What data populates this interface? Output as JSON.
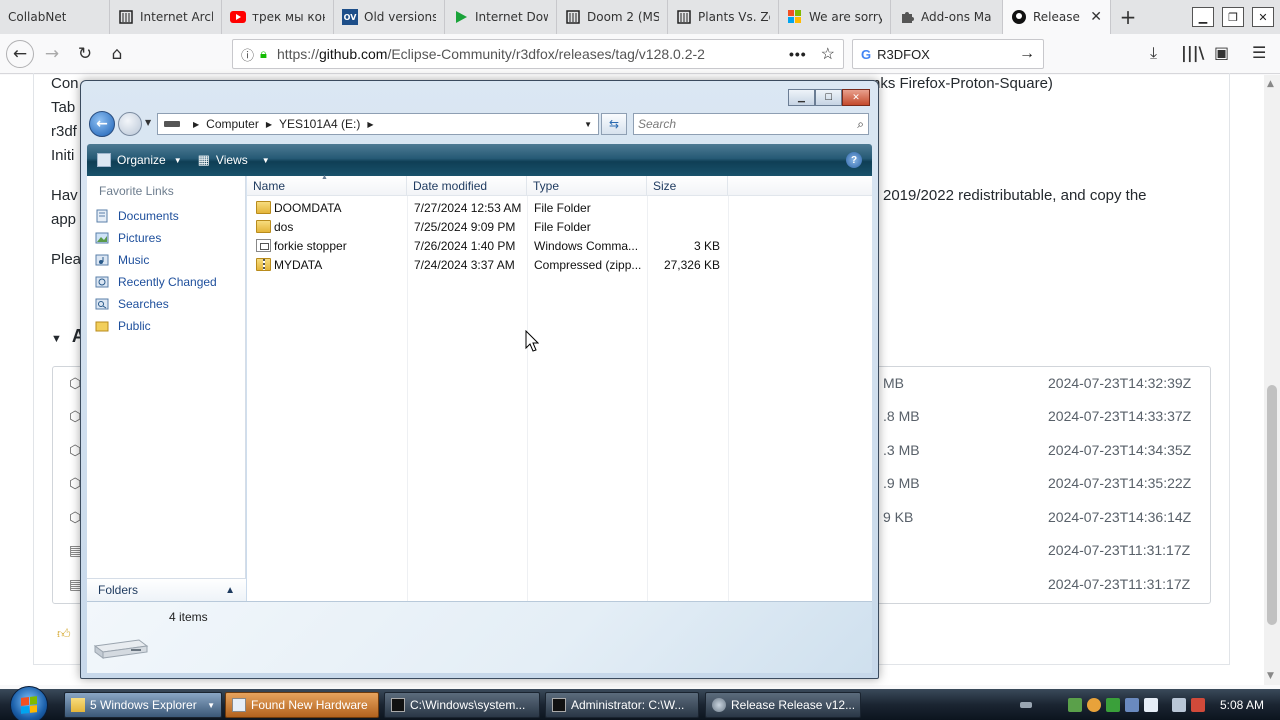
{
  "browser": {
    "tabs": [
      {
        "label": "CollabNet",
        "icon": "collabnet-icon"
      },
      {
        "label": "Internet Arch",
        "icon": "archive-icon"
      },
      {
        "label": "трек мы кон",
        "icon": "youtube-icon"
      },
      {
        "label": "Old versions",
        "icon": "oldversion-icon"
      },
      {
        "label": "Internet Dow",
        "icon": "play-icon"
      },
      {
        "label": "Doom 2 (MS",
        "icon": "archive-icon"
      },
      {
        "label": "Plants Vs. Zo",
        "icon": "archive-icon"
      },
      {
        "label": "We are sorry,",
        "icon": "microsoft-icon"
      },
      {
        "label": "Add-ons Ma",
        "icon": "puzzle-icon"
      },
      {
        "label": "Release R",
        "icon": "github-icon"
      }
    ],
    "url": "https://github.com/Eclipse-Community/r3dfox/releases/tag/v128.0.2-2",
    "url_host": "github.com",
    "search_text": "R3DFOX"
  },
  "page": {
    "lines": [
      "Con",
      "nks Firefox-Proton-Square)",
      "Tab",
      "r3df",
      "Initi",
      "Hav",
      "2019/2022 redistributable, and copy the",
      "app",
      "Plea"
    ],
    "assets_label": "A",
    "assets": [
      {
        "size": "MB",
        "date": "2024-07-23T14:32:39Z"
      },
      {
        "size": ".8 MB",
        "date": "2024-07-23T14:33:37Z"
      },
      {
        "size": ".3 MB",
        "date": "2024-07-23T14:34:35Z"
      },
      {
        "size": ".9 MB",
        "date": "2024-07-23T14:35:22Z"
      },
      {
        "size": "9 KB",
        "date": "2024-07-23T14:36:14Z"
      },
      {
        "size": "",
        "date": "2024-07-23T11:31:17Z"
      },
      {
        "size": "",
        "date": "2024-07-23T11:31:17Z"
      }
    ]
  },
  "explorer": {
    "breadcrumb": [
      "Computer",
      "YES101A4 (E:)"
    ],
    "search_placeholder": "Search",
    "toolbar": {
      "organize": "Organize",
      "views": "Views"
    },
    "favorite_links_header": "Favorite Links",
    "favorites": [
      {
        "label": "Documents",
        "icon": "documents-icon"
      },
      {
        "label": "Pictures",
        "icon": "pictures-icon"
      },
      {
        "label": "Music",
        "icon": "music-icon"
      },
      {
        "label": "Recently Changed",
        "icon": "recent-icon"
      },
      {
        "label": "Searches",
        "icon": "searches-icon"
      },
      {
        "label": "Public",
        "icon": "public-folder-icon"
      }
    ],
    "folders_label": "Folders",
    "columns": [
      "Name",
      "Date modified",
      "Type",
      "Size"
    ],
    "files": [
      {
        "name": "DOOMDATA",
        "date": "7/27/2024 12:53 AM",
        "type": "File Folder",
        "size": "",
        "icon": "folder-icon"
      },
      {
        "name": "dos",
        "date": "7/25/2024 9:09 PM",
        "type": "File Folder",
        "size": "",
        "icon": "folder-icon"
      },
      {
        "name": "forkie stopper",
        "date": "7/26/2024 1:40 PM",
        "type": "Windows Comma...",
        "size": "3 KB",
        "icon": "batch-file-icon"
      },
      {
        "name": "MYDATA",
        "date": "7/24/2024 3:37 AM",
        "type": "Compressed (zipp...",
        "size": "27,326 KB",
        "icon": "zip-folder-icon"
      }
    ],
    "item_count": "4 items"
  },
  "taskbar": {
    "buttons": [
      {
        "label": "5 Windows Explorer",
        "state": "active"
      },
      {
        "label": "Found New Hardware",
        "state": "flash"
      },
      {
        "label": "C:\\Windows\\system...",
        "state": "normal"
      },
      {
        "label": "Administrator: C:\\W...",
        "state": "normal"
      },
      {
        "label": "Release Release v12...",
        "state": "normal"
      }
    ],
    "clock": "5:08 AM"
  }
}
